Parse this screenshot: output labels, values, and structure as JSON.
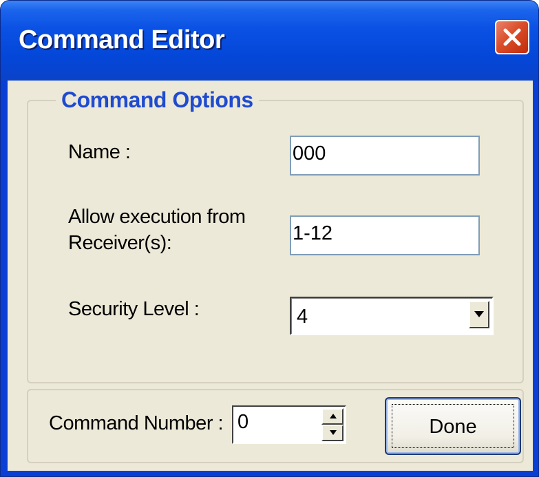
{
  "window": {
    "title": "Command Editor",
    "close_icon": "close-icon"
  },
  "options_group": {
    "legend": "Command Options",
    "name_label": "Name :",
    "name_value": "000",
    "receivers_label_line1": "Allow execution from",
    "receivers_label_line2": "Receiver(s):",
    "receivers_value": "1-12",
    "security_label": "Security Level :",
    "security_value": "4"
  },
  "number_group": {
    "label": "Command Number :",
    "value": "0"
  },
  "buttons": {
    "done": "Done"
  },
  "colors": {
    "titlebar": "#0a51e4",
    "client_bg": "#ece9d8",
    "legend_text": "#1f4bcf",
    "close_button": "#db4d2a"
  }
}
